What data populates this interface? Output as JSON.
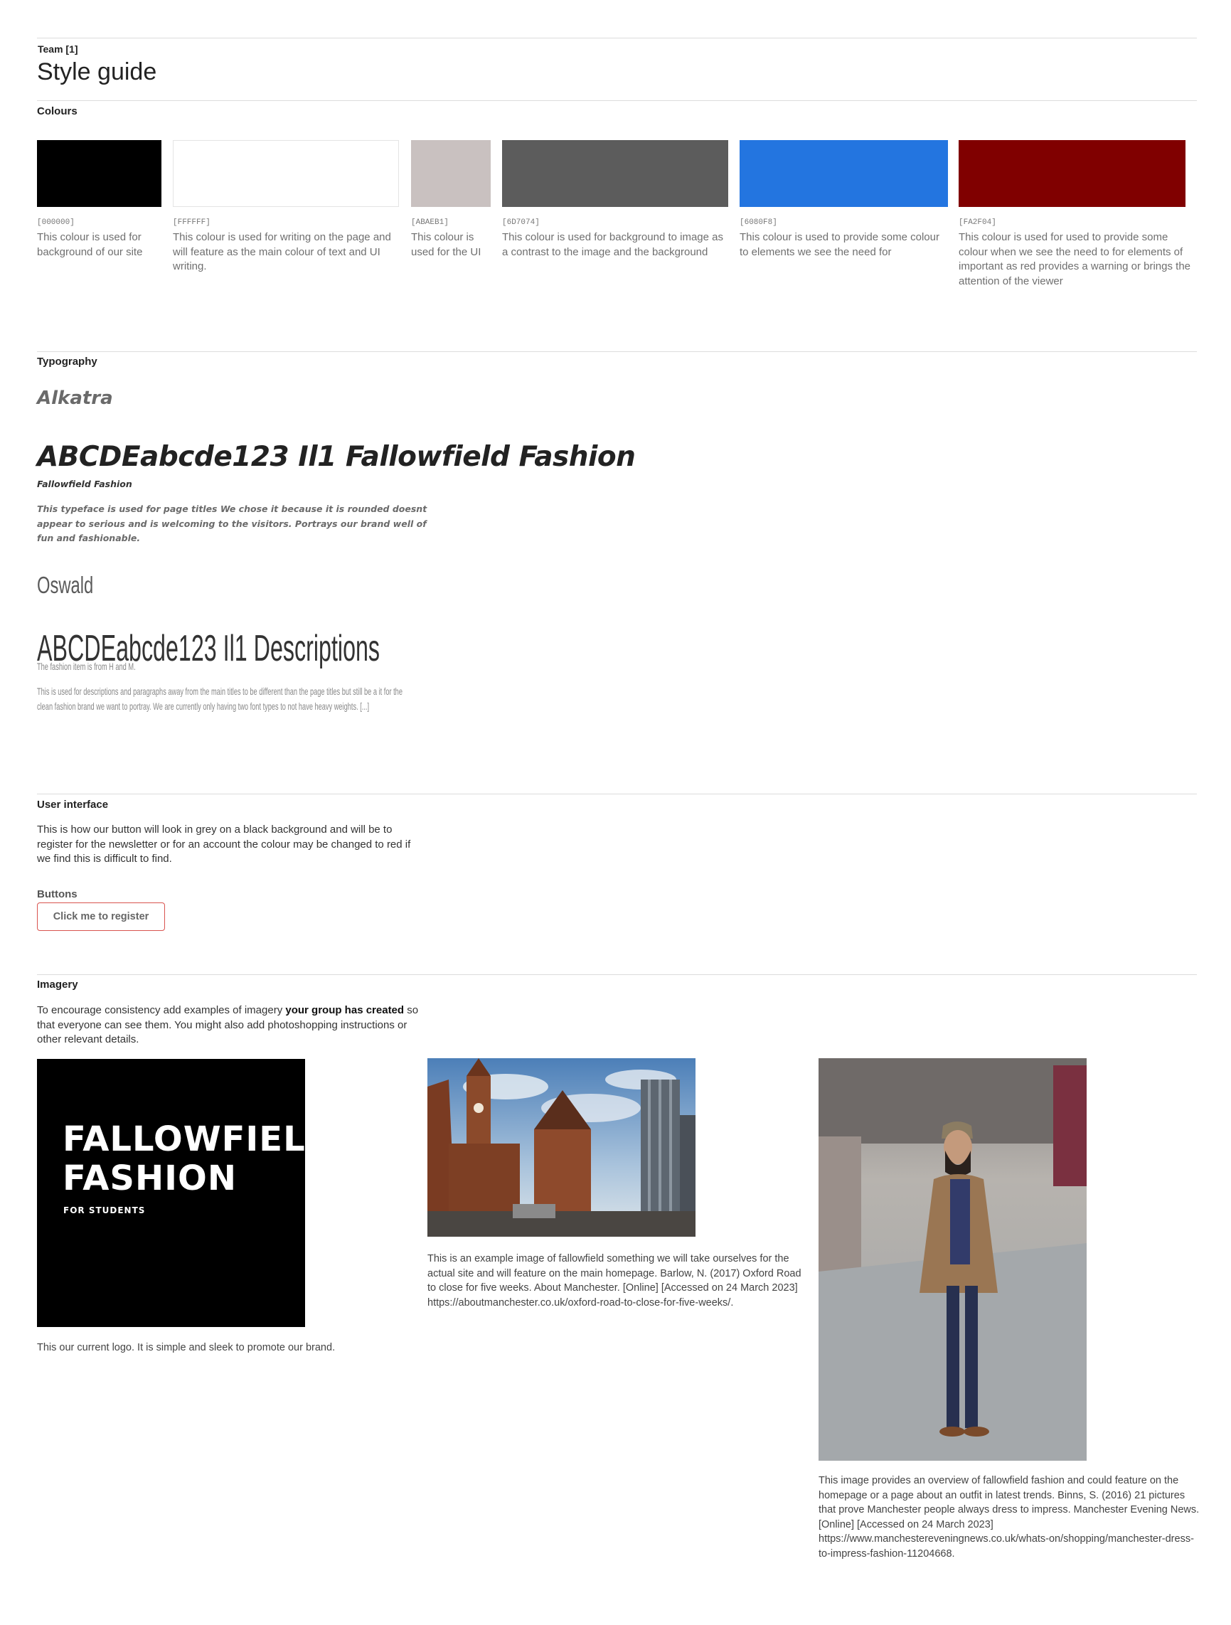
{
  "header": {
    "team": "Team [1]",
    "title": "Style guide"
  },
  "colours": {
    "heading": "Colours",
    "swatches": [
      {
        "hex_label": "[000000]",
        "color": "#000000",
        "description": "This colour is used for background of our site"
      },
      {
        "hex_label": "[FFFFFF]",
        "color": "#FFFFFF",
        "description": "This colour is used for writing on the page and will feature as the main colour of text and UI writing."
      },
      {
        "hex_label": "[ABAEB1]",
        "color": "#C9C1C0",
        "description": "This colour is used for the UI"
      },
      {
        "hex_label": "[6D7074]",
        "color": "#5C5C5C",
        "description": "This colour is used for background to image as a contrast to the image and the background"
      },
      {
        "hex_label": "[6080F8]",
        "color": "#2375E0",
        "description": "This colour is used to provide some colour to elements we see the need for"
      },
      {
        "hex_label": "[FA2F04]",
        "color": "#800000",
        "description": "This colour is used for used to provide some colour when we see the need to for elements of important as red provides a warning or brings the attention of the viewer"
      }
    ]
  },
  "typography": {
    "heading": "Typography",
    "fonts": [
      {
        "name": "Alkatra",
        "sample": "ABCDEabcde123 Il1 Fallowfield Fashion",
        "sample_small": "Fallowfield Fashion",
        "description": "This typeface is used for page titles We chose it because it is rounded doesnt appear to serious and is welcoming to the visitors. Portrays our brand well of fun and fashionable."
      },
      {
        "name": "Oswald",
        "sample": "ABCDEabcde123 Il1 Descriptions",
        "sample_small": "The fashion item is from H and M.",
        "description": "This is used for descriptions and paragraphs away from the main titles to be different than the page titles but still be a it for the clean fashion brand we want to portray. We are currently only having two font types to not have heavy weights. [...]"
      }
    ]
  },
  "user_interface": {
    "heading": "User interface",
    "description": "This is how our button will look in grey on a black background and will be to register for the newsletter or for an account the colour may be changed to red if we find this is difficult to find.",
    "buttons_label": "Buttons",
    "button_label": "Click me to register"
  },
  "imagery": {
    "heading": "Imagery",
    "intro_before": "To encourage consistency add examples of imagery ",
    "intro_bold": "your group has created",
    "intro_after": " so that everyone can see them. You might also add photoshopping instructions or other relevant details.",
    "logo": {
      "line1": "FALLOWFIELD",
      "line2": "FASHION",
      "tagline": "FOR STUDENTS"
    },
    "logo_caption": "This our current logo. It is simple and sleek to promote our brand.",
    "street_caption": "This is an example image of fallowfield something we will take ourselves for the actual site and will feature on the main homepage. Barlow, N. (2017) Oxford Road to close for five weeks. About Manchester. [Online] [Accessed on 24 March 2023] https://aboutmanchester.co.uk/oxford-road-to-close-for-five-weeks/.",
    "person_caption": "This image provides an overview of fallowfield fashion and could feature on the homepage or a page about an outfit in latest trends. Binns, S. (2016) 21 pictures that prove Manchester people always dress to impress. Manchester Evening News. [Online] [Accessed on 24 March 2023] https://www.manchestereveningnews.co.uk/whats-on/shopping/manchester-dress-to-impress-fashion-11204668."
  }
}
